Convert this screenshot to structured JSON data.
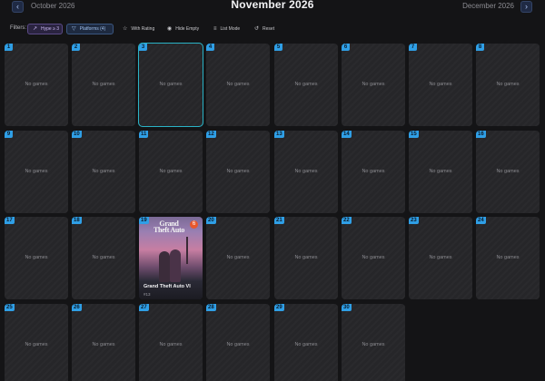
{
  "header": {
    "prev_label": "October 2026",
    "next_label": "December 2026",
    "title": "November 2026",
    "prev_icon": "chevron-left-icon",
    "next_icon": "chevron-right-icon"
  },
  "filters": {
    "label": "Filters:",
    "chips": [
      {
        "label": "Hype ≥ 3",
        "icon": "trend-icon",
        "active": true
      },
      {
        "label": "Platforms (4)",
        "icon": "filter-icon",
        "active": true
      },
      {
        "label": "With Rating",
        "icon": "star-icon",
        "active": false
      },
      {
        "label": "Hide Empty",
        "icon": "eye-icon",
        "active": false
      },
      {
        "label": "List Mode",
        "icon": "list-icon",
        "active": false
      },
      {
        "label": "Reset",
        "icon": "reset-icon",
        "active": false
      }
    ]
  },
  "calendar": {
    "empty_label": "No games",
    "selected_day": 3,
    "days": [
      "1",
      "2",
      "3",
      "4",
      "5",
      "6",
      "7",
      "8",
      "9",
      "10",
      "11",
      "12",
      "13",
      "14",
      "15",
      "16",
      "17",
      "18",
      "19",
      "20",
      "21",
      "22",
      "23",
      "24",
      "25",
      "26",
      "27",
      "28",
      "29",
      "30"
    ],
    "games": {
      "19": {
        "title": "Grand Theft Auto VI",
        "subtitle": "#13",
        "art_text": "Grand Theft Auto",
        "badge": "6"
      }
    }
  },
  "colors": {
    "accent": "#2f9fe6",
    "selected_outline": "#2ab3c6",
    "background": "#141416",
    "cell": "#262629"
  }
}
